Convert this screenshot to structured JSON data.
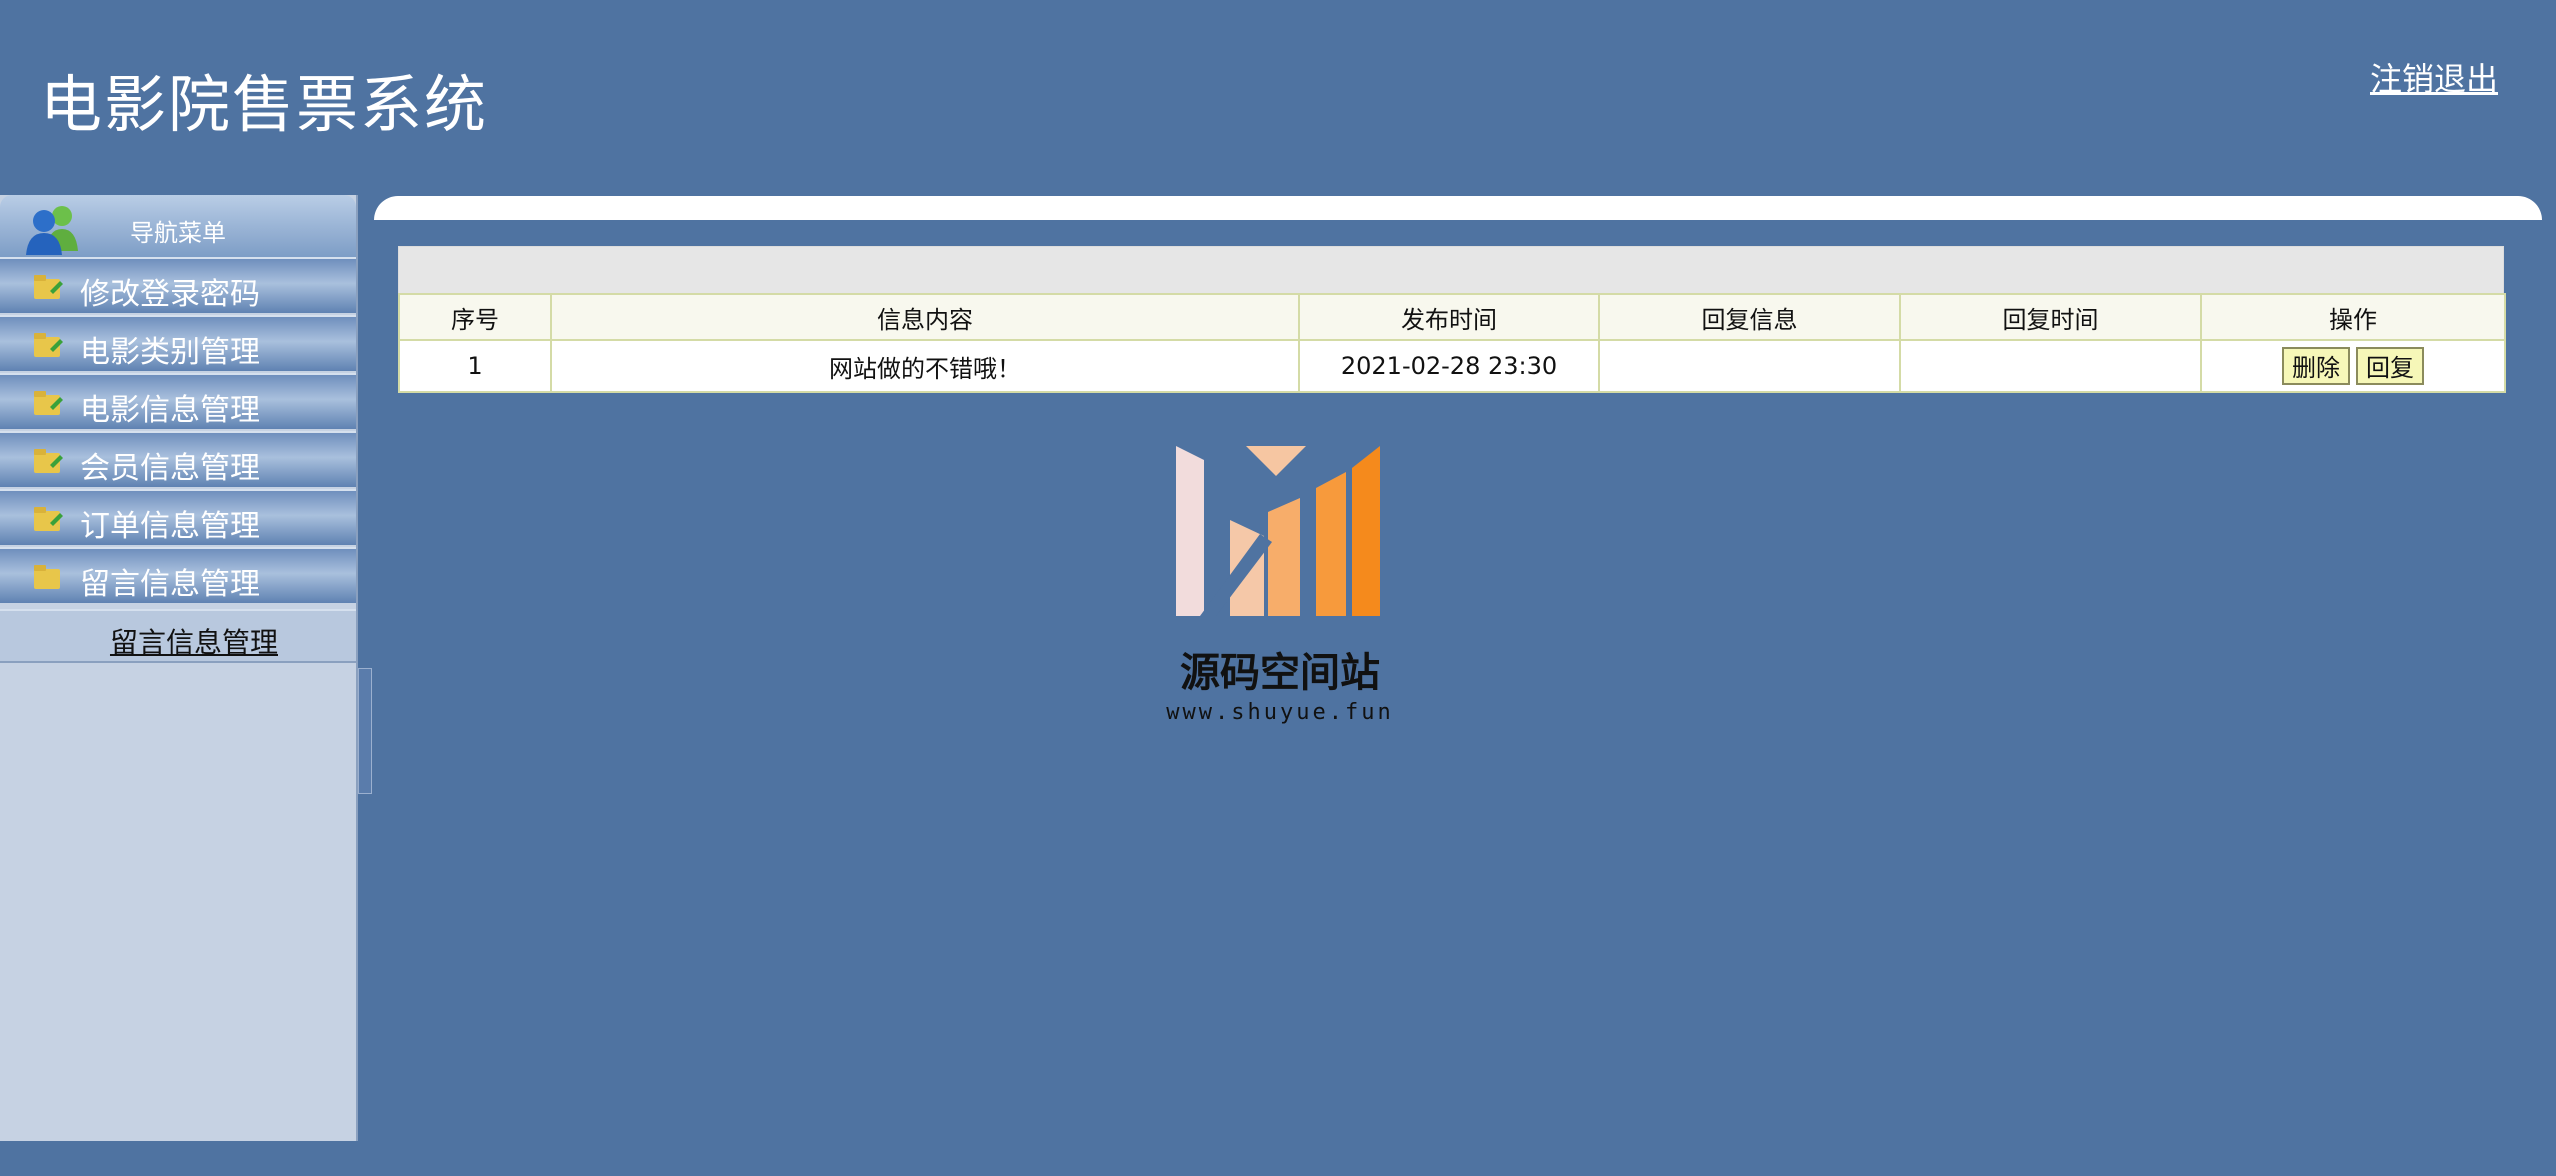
{
  "header": {
    "title": "电影院售票系统",
    "logout_label": "注销退出"
  },
  "sidebar": {
    "title": "导航菜单",
    "items": [
      {
        "label": "修改登录密码",
        "icon": "folder-icon"
      },
      {
        "label": "电影类别管理",
        "icon": "folder-icon"
      },
      {
        "label": "电影信息管理",
        "icon": "folder-icon"
      },
      {
        "label": "会员信息管理",
        "icon": "folder-icon"
      },
      {
        "label": "订单信息管理",
        "icon": "folder-icon"
      },
      {
        "label": "留言信息管理",
        "icon": "folder-icon"
      }
    ],
    "submenu": {
      "label": "留言信息管理"
    }
  },
  "table": {
    "columns": [
      "序号",
      "信息内容",
      "发布时间",
      "回复信息",
      "回复时间",
      "操作"
    ],
    "rows": [
      {
        "index": "1",
        "content": "网站做的不错哦！",
        "published": "2021-02-28 23:30",
        "reply": "",
        "reply_time": "",
        "actions": {
          "delete": "删除",
          "reply": "回复"
        }
      }
    ]
  },
  "watermark": {
    "title": "源码空间站",
    "url": "www.shuyue.fun"
  },
  "colors": {
    "background": "#4f73a1",
    "sidebar": "#c6d2e3",
    "button": "#f6f7b8",
    "table_border": "#d4dba6"
  }
}
